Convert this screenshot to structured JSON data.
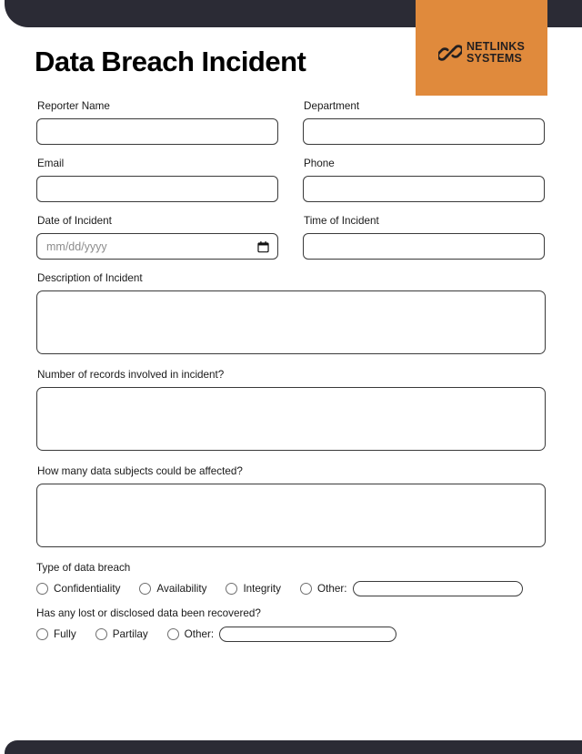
{
  "brand": {
    "accent_color": "#e08a3c",
    "dark_color": "#2b2b35",
    "logo_line1": "NETLINKS",
    "logo_line2": "SYSTEMS",
    "logo_icon": "chain-link-icon"
  },
  "header": {
    "title": "Data Breach Incident"
  },
  "form": {
    "fields": {
      "reporter_name": {
        "label": "Reporter Name",
        "value": "",
        "placeholder": ""
      },
      "department": {
        "label": "Department",
        "value": "",
        "placeholder": ""
      },
      "email": {
        "label": "Email",
        "value": "",
        "placeholder": ""
      },
      "phone": {
        "label": "Phone",
        "value": "",
        "placeholder": ""
      },
      "date_of_incident": {
        "label": "Date of Incident",
        "value": "",
        "placeholder": "mm/dd/yyyy",
        "icon": "calendar-icon"
      },
      "time_of_incident": {
        "label": "Time of Incident",
        "value": "",
        "placeholder": ""
      },
      "description": {
        "label": "Description of Incident",
        "value": "",
        "placeholder": ""
      },
      "records_count": {
        "label": "Number of records involved in incident?",
        "value": "",
        "placeholder": ""
      },
      "data_subjects": {
        "label": "How many data subjects could be affected?",
        "value": "",
        "placeholder": ""
      }
    },
    "breach_type": {
      "label": "Type of data breach",
      "options": [
        {
          "label": "Confidentiality",
          "selected": false
        },
        {
          "label": "Availability",
          "selected": false
        },
        {
          "label": "Integrity",
          "selected": false
        }
      ],
      "other_label": "Other:",
      "other_value": "",
      "other_placeholder": ""
    },
    "recovered": {
      "label": "Has any lost or disclosed data been recovered?",
      "options": [
        {
          "label": "Fully",
          "selected": false
        },
        {
          "label": "Partilay",
          "selected": false
        }
      ],
      "other_label": "Other:",
      "other_value": "",
      "other_placeholder": ""
    }
  }
}
